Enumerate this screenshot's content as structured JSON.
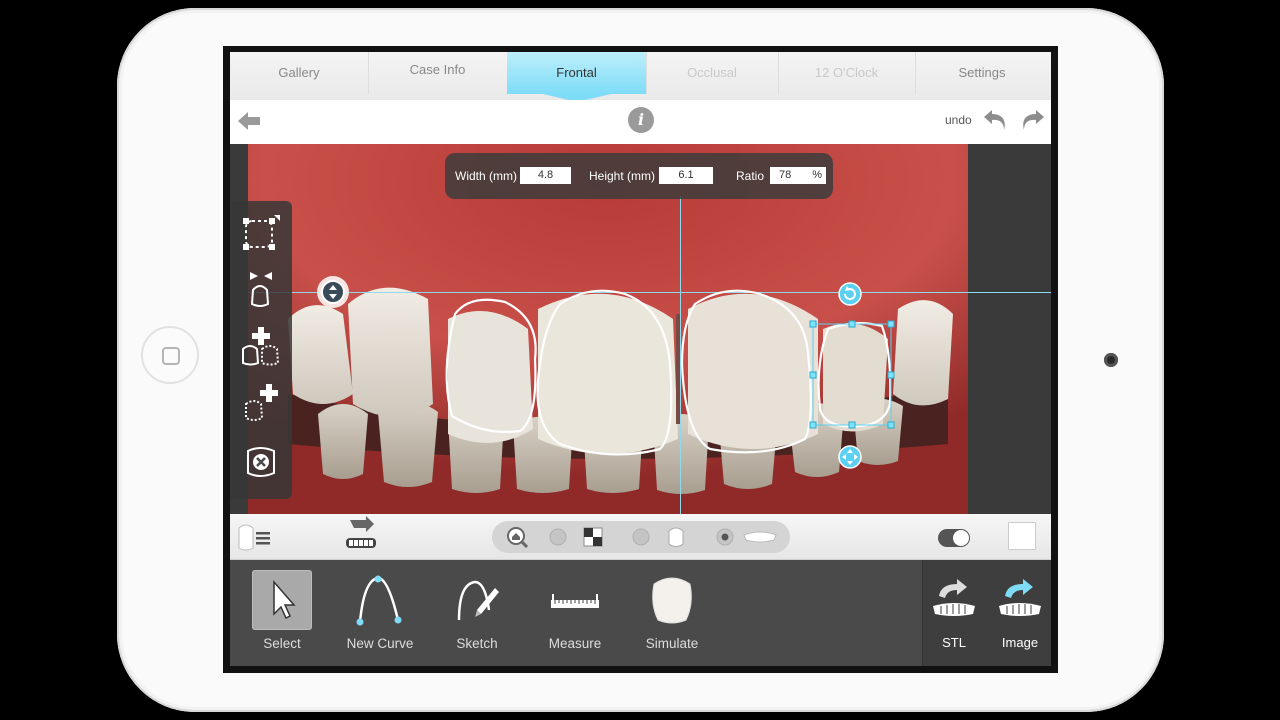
{
  "tabs": [
    {
      "label": "Gallery",
      "state": "normal"
    },
    {
      "label": "Case Info",
      "state": "normal"
    },
    {
      "label": "Frontal",
      "state": "active"
    },
    {
      "label": "Occlusal",
      "state": "disabled"
    },
    {
      "label": "12 O'Clock",
      "state": "disabled"
    },
    {
      "label": "Settings",
      "state": "normal"
    }
  ],
  "nav": {
    "back_icon": "back-arrow-icon",
    "info_icon": "info-icon",
    "info_glyph": "i",
    "undo_label": "undo",
    "undo_icon": "undo-arrow-icon",
    "redo_icon": "redo-arrow-icon"
  },
  "dimensions": {
    "width_label": "Width (mm)",
    "width_value": "4.8",
    "height_label": "Height (mm)",
    "height_value": "6.1",
    "ratio_label": "Ratio",
    "ratio_value": "78",
    "ratio_unit": "%"
  },
  "left_tools": [
    "select-bounding-box-icon",
    "compress-shape-icon",
    "add-tooth-pair-icon",
    "add-tooth-icon",
    "delete-shape-icon"
  ],
  "subbar": {
    "left_icons": [
      "tooth-list-icon",
      "tooth-import-icon"
    ],
    "segment_icons": [
      "zoom-home-icon",
      "opacity-low-icon",
      "contrast-icon",
      "opacity-mid-icon",
      "tooth-outline-icon",
      "opacity-full-icon",
      "teeth-row-icon"
    ],
    "toggle_state": "on",
    "swatch_color": "#ffffff"
  },
  "toolbar": {
    "tools": [
      {
        "label": "Select",
        "icon": "cursor-arrow-icon",
        "selected": true
      },
      {
        "label": "New Curve",
        "icon": "curve-icon",
        "selected": false
      },
      {
        "label": "Sketch",
        "icon": "sketch-pen-icon",
        "selected": false
      },
      {
        "label": "Measure",
        "icon": "ruler-icon",
        "selected": false
      },
      {
        "label": "Simulate",
        "icon": "tooth-simulate-icon",
        "selected": false
      }
    ],
    "export": [
      {
        "label": "STL",
        "icon": "export-stl-icon"
      },
      {
        "label": "Image",
        "icon": "export-image-icon"
      }
    ]
  },
  "colors": {
    "accent": "#7fdcf7",
    "handle": "#5cd0f0",
    "toolbar_bg": "#4a4a4a"
  }
}
